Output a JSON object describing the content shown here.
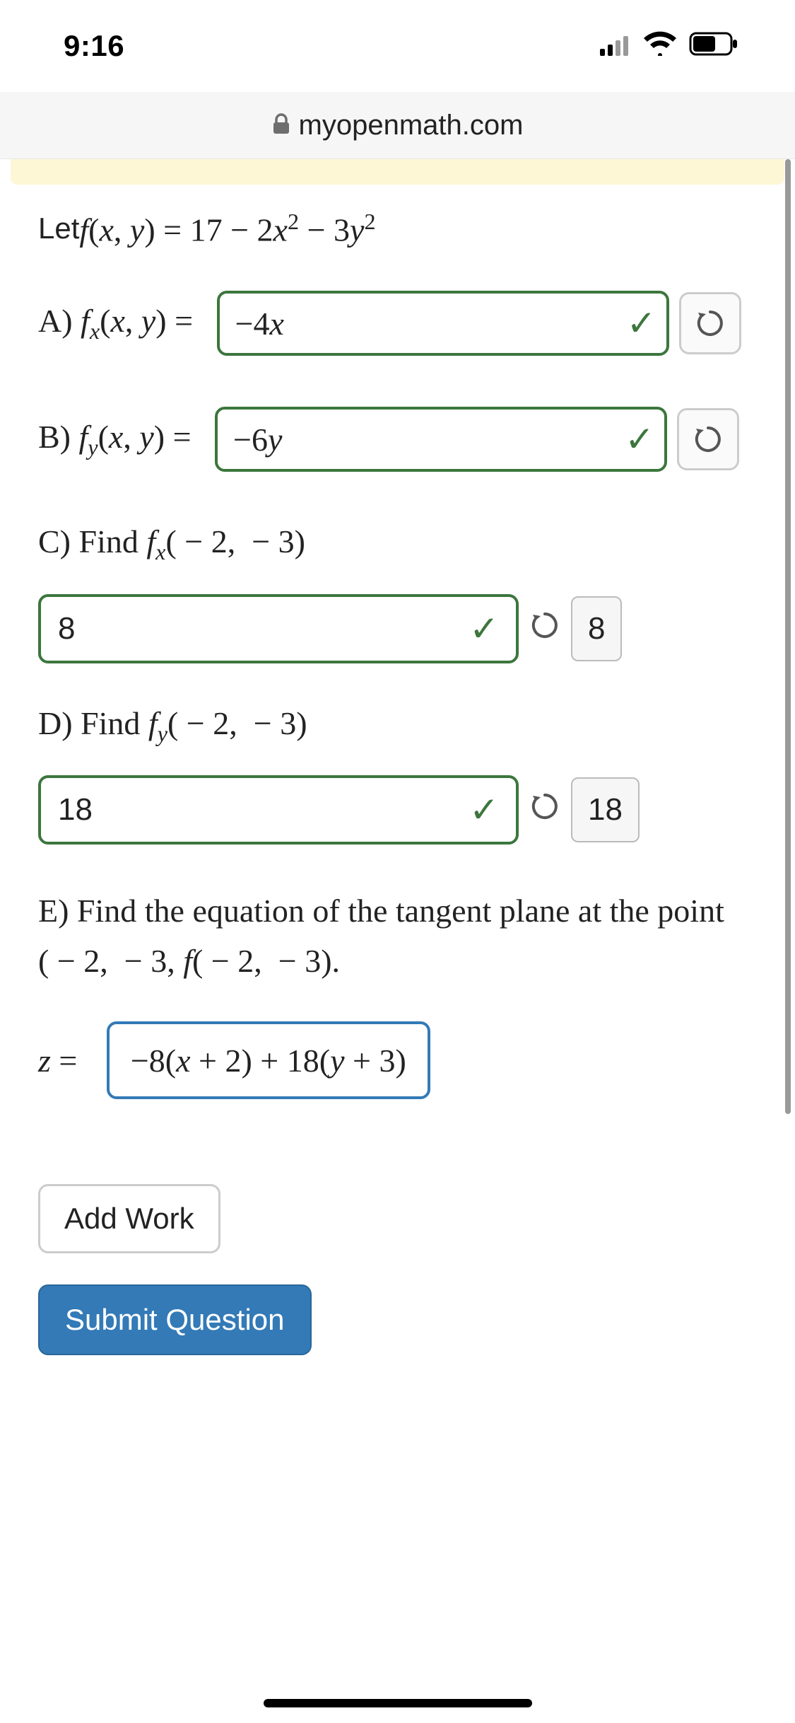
{
  "status": {
    "time": "9:16",
    "wifi_icon": "wifi-icon",
    "signal_icon": "signal-icon",
    "battery_icon": "battery-icon"
  },
  "browser": {
    "domain": "myopenmath.com"
  },
  "question": {
    "prompt_let": "Let ",
    "prompt_func": "f(x, y) = 17 − 2x² − 3y²",
    "partA": {
      "label": "A) fₓ(x, y) = ",
      "value": "−4x"
    },
    "partB": {
      "label": "B) f_y(x, y) = ",
      "value": "−6y"
    },
    "partC": {
      "label": "C) Find fₓ( − 2,  − 3)",
      "value": "8",
      "answer_display": "8"
    },
    "partD": {
      "label": "D) Find f_y( − 2,  − 3)",
      "value": "18",
      "answer_display": "18"
    },
    "partE": {
      "label": "E) Find the equation of the tangent plane at the point ( − 2,  − 3, f( − 2,  − 3).",
      "z_label": "z = ",
      "value": "−8(x + 2) + 18(y + 3)"
    }
  },
  "buttons": {
    "add_work": "Add Work",
    "submit": "Submit Question"
  }
}
